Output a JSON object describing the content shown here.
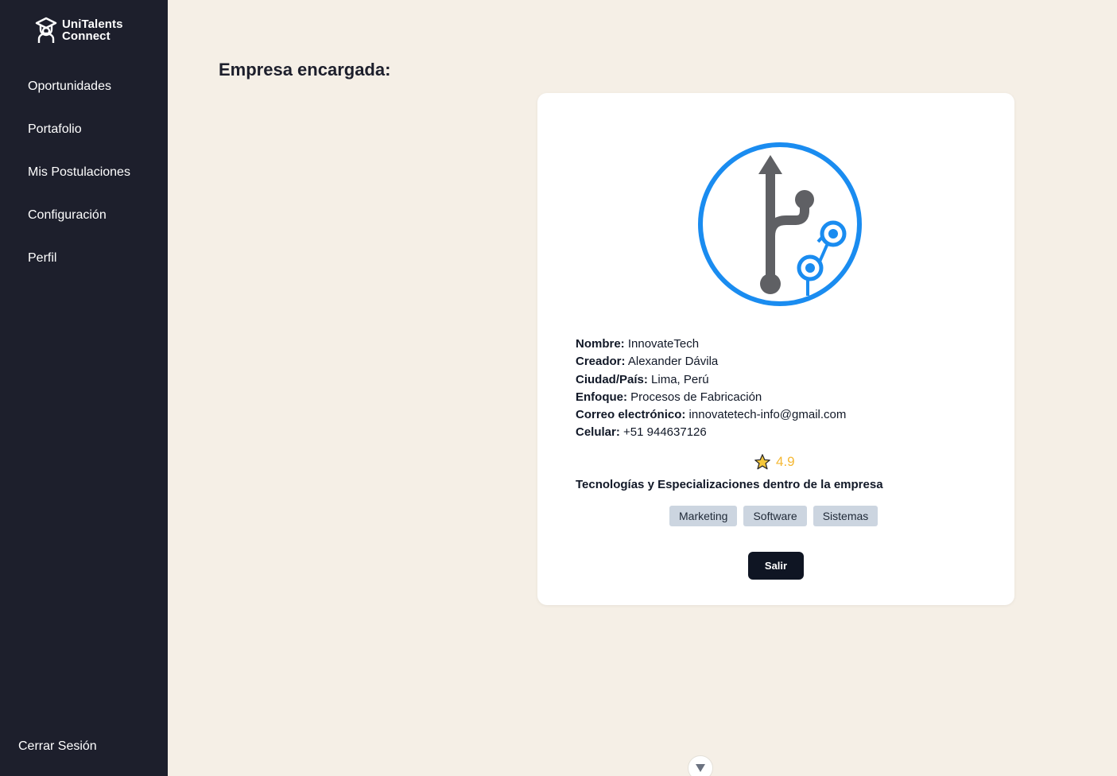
{
  "brand": {
    "line1": "UniTalents",
    "line2": "Connect",
    "icon": "graduate-icon"
  },
  "sidebar": {
    "items": [
      {
        "label": "Oportunidades"
      },
      {
        "label": "Portafolio"
      },
      {
        "label": "Mis Postulaciones"
      },
      {
        "label": "Configuración"
      },
      {
        "label": "Perfil"
      }
    ],
    "logout_label": "Cerrar Sesión"
  },
  "main": {
    "title": "Empresa encargada:"
  },
  "company": {
    "logo_icon": "git-branch-logo-icon",
    "fields": [
      {
        "label": "Nombre:",
        "value": "InnovateTech"
      },
      {
        "label": "Creador:",
        "value": "Alexander Dávila"
      },
      {
        "label": "Ciudad/País:",
        "value": "Lima, Perú"
      },
      {
        "label": "Enfoque:",
        "value": "Procesos de Fabricación"
      },
      {
        "label": "Correo electrónico:",
        "value": "innovatetech-info@gmail.com"
      },
      {
        "label": "Celular:",
        "value": "+51 944637126"
      }
    ],
    "rating": "4.9",
    "tech_title": "Tecnologías y Especializaciones dentro de la empresa",
    "tags": [
      "Marketing",
      "Software",
      "Sistemas"
    ],
    "exit_label": "Salir"
  },
  "colors": {
    "sidebar_bg": "#1d1f2c",
    "page_bg": "#f5efe6",
    "logo_blue": "#1a8cf0",
    "logo_gray": "#5f6064",
    "rating": "#f5b833",
    "tag_bg": "#ccd5e0",
    "button_bg": "#0f1523"
  }
}
